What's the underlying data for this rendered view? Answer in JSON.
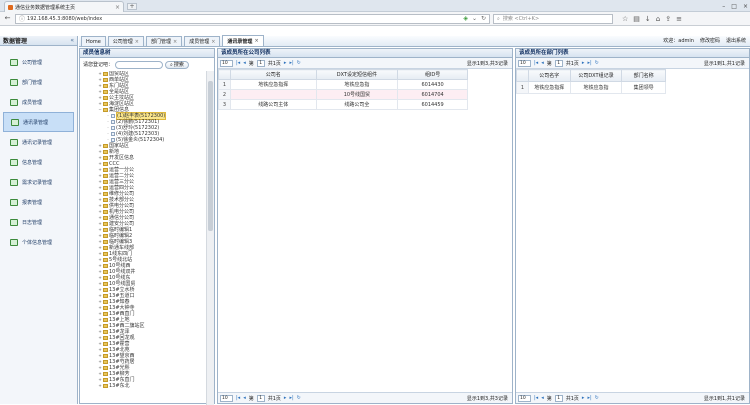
{
  "browser": {
    "tab_title": "通信业务数据管理系统主页",
    "url": "192.168.45.3:8080/web/index",
    "search_placeholder": "搜索 <Ctrl+K>"
  },
  "app": {
    "left_title": "数据管理",
    "collapse_glyph": "«",
    "menu": [
      {
        "label": "公司管理"
      },
      {
        "label": "部门管理"
      },
      {
        "label": "成员管理"
      },
      {
        "label": "通讯录管理"
      },
      {
        "label": "通讯记录管理"
      },
      {
        "label": "信息管理"
      },
      {
        "label": "需求记录管理"
      },
      {
        "label": "报表管理"
      },
      {
        "label": "日志管理"
      },
      {
        "label": "个体信息管理"
      }
    ],
    "tabs": [
      {
        "label": "Home"
      },
      {
        "label": "公司管理"
      },
      {
        "label": "部门管理"
      },
      {
        "label": "成员管理"
      },
      {
        "label": "通讯录管理"
      }
    ],
    "user": {
      "label": "欢迎：admin",
      "change_pwd": "修改密码",
      "logout": "退出系统"
    }
  },
  "tree_panel": {
    "title": "成员信息树",
    "search_label": "请您登记吧：",
    "search_button": "搜索",
    "nodes": [
      {
        "label": "国贸站区",
        "level": 1,
        "type": "folder"
      },
      {
        "label": "西单站区",
        "level": 1,
        "type": "folder"
      },
      {
        "label": "东门站区",
        "level": 1,
        "type": "folder"
      },
      {
        "label": "全是站区",
        "level": 1,
        "type": "folder"
      },
      {
        "label": "公主坟站区",
        "level": 1,
        "type": "folder"
      },
      {
        "label": "海淀区站区",
        "level": 1,
        "type": "folder"
      },
      {
        "label": "集团信息",
        "level": 1,
        "type": "folder"
      },
      {
        "label": "(1)赵丰表(5172300)",
        "level": 2,
        "type": "leaf",
        "selected": true
      },
      {
        "label": "(2)徐鹏(5172301)",
        "level": 2,
        "type": "leaf"
      },
      {
        "label": "(3)舒玲(5172302)",
        "level": 2,
        "type": "leaf"
      },
      {
        "label": "(4)刘建(5172303)",
        "level": 2,
        "type": "leaf"
      },
      {
        "label": "(5)徐金炎(5172304)",
        "level": 2,
        "type": "leaf"
      },
      {
        "label": "国家站区",
        "level": 1,
        "type": "folder"
      },
      {
        "label": "新地",
        "level": 1,
        "type": "folder"
      },
      {
        "label": "开发区信息",
        "level": 1,
        "type": "folder"
      },
      {
        "label": "CCC",
        "level": 1,
        "type": "folder"
      },
      {
        "label": "运营一分公",
        "level": 1,
        "type": "folder"
      },
      {
        "label": "运营二分公",
        "level": 1,
        "type": "folder"
      },
      {
        "label": "运营三分公",
        "level": 1,
        "type": "folder"
      },
      {
        "label": "运营四分公",
        "level": 1,
        "type": "folder"
      },
      {
        "label": "维修分公司",
        "level": 1,
        "type": "folder"
      },
      {
        "label": "技术部分公",
        "level": 1,
        "type": "folder"
      },
      {
        "label": "供电分公司",
        "level": 1,
        "type": "folder"
      },
      {
        "label": "机电分公司",
        "level": 1,
        "type": "folder"
      },
      {
        "label": "通信分公司",
        "level": 1,
        "type": "folder"
      },
      {
        "label": "建安分公司",
        "level": 1,
        "type": "folder"
      },
      {
        "label": "临时编辑1",
        "level": 1,
        "type": "folder"
      },
      {
        "label": "临时编辑2",
        "level": 1,
        "type": "folder"
      },
      {
        "label": "临时编辑3",
        "level": 1,
        "type": "folder"
      },
      {
        "label": "新通车线部",
        "level": 1,
        "type": "folder"
      },
      {
        "label": "1线东四门",
        "level": 1,
        "type": "folder"
      },
      {
        "label": "5号线北站",
        "level": 1,
        "type": "folder"
      },
      {
        "label": "10号线西",
        "level": 1,
        "type": "folder"
      },
      {
        "label": "10号线双井",
        "level": 1,
        "type": "folder"
      },
      {
        "label": "10号线东",
        "level": 1,
        "type": "folder"
      },
      {
        "label": "10号线国贸",
        "level": 1,
        "type": "folder"
      },
      {
        "label": "13#立水桥",
        "level": 1,
        "type": "folder"
      },
      {
        "label": "13#五道口",
        "level": 1,
        "type": "folder"
      },
      {
        "label": "13#知春",
        "level": 1,
        "type": "folder"
      },
      {
        "label": "13#大钟寺",
        "level": 1,
        "type": "folder"
      },
      {
        "label": "13#西直门",
        "level": 1,
        "type": "folder"
      },
      {
        "label": "13#上地",
        "level": 1,
        "type": "folder"
      },
      {
        "label": "13#西二旗站区",
        "level": 1,
        "type": "folder"
      },
      {
        "label": "13#龙泽",
        "level": 1,
        "type": "folder"
      },
      {
        "label": "13#回龙观",
        "level": 1,
        "type": "folder"
      },
      {
        "label": "13#霍营",
        "level": 1,
        "type": "folder"
      },
      {
        "label": "13#北苑",
        "level": 1,
        "type": "folder"
      },
      {
        "label": "13#望京西",
        "level": 1,
        "type": "folder"
      },
      {
        "label": "13#芍药居",
        "level": 1,
        "type": "folder"
      },
      {
        "label": "13#光熙",
        "level": 1,
        "type": "folder"
      },
      {
        "label": "13#柳芳",
        "level": 1,
        "type": "folder"
      },
      {
        "label": "13#东直门",
        "level": 1,
        "type": "folder"
      },
      {
        "label": "13#东北",
        "level": 1,
        "type": "folder"
      }
    ]
  },
  "grid1": {
    "title": "该成员所在公司列表",
    "page_size": "10",
    "page_prefix": "第",
    "page_value": "1",
    "page_suffix": "共1页",
    "info": "显示1到3,共3记录",
    "columns": [
      "公司名",
      "DXT设定短信组件",
      "组ID号"
    ],
    "rows": [
      {
        "n": "1",
        "c1": "地铁应急指挥",
        "c2": "地铁应急指",
        "c3": "6014430"
      },
      {
        "n": "2",
        "c1": "",
        "c2": "10号线国贸",
        "c3": "6014704"
      },
      {
        "n": "3",
        "c1": "线路公司主体",
        "c2": "线路公司全",
        "c3": "6014459"
      }
    ]
  },
  "grid2": {
    "title": "该成员所在部门列表",
    "page_size": "10",
    "page_prefix": "第",
    "page_value": "1",
    "page_suffix": "共1页",
    "info": "显示1到1,共1记录",
    "columns": [
      "公司名字",
      "公司DXT组记录",
      "部门名称"
    ],
    "rows": [
      {
        "n": "1",
        "c1": "地铁应急指挥",
        "c2": "地铁应急指",
        "c3": "集团领导"
      }
    ]
  }
}
